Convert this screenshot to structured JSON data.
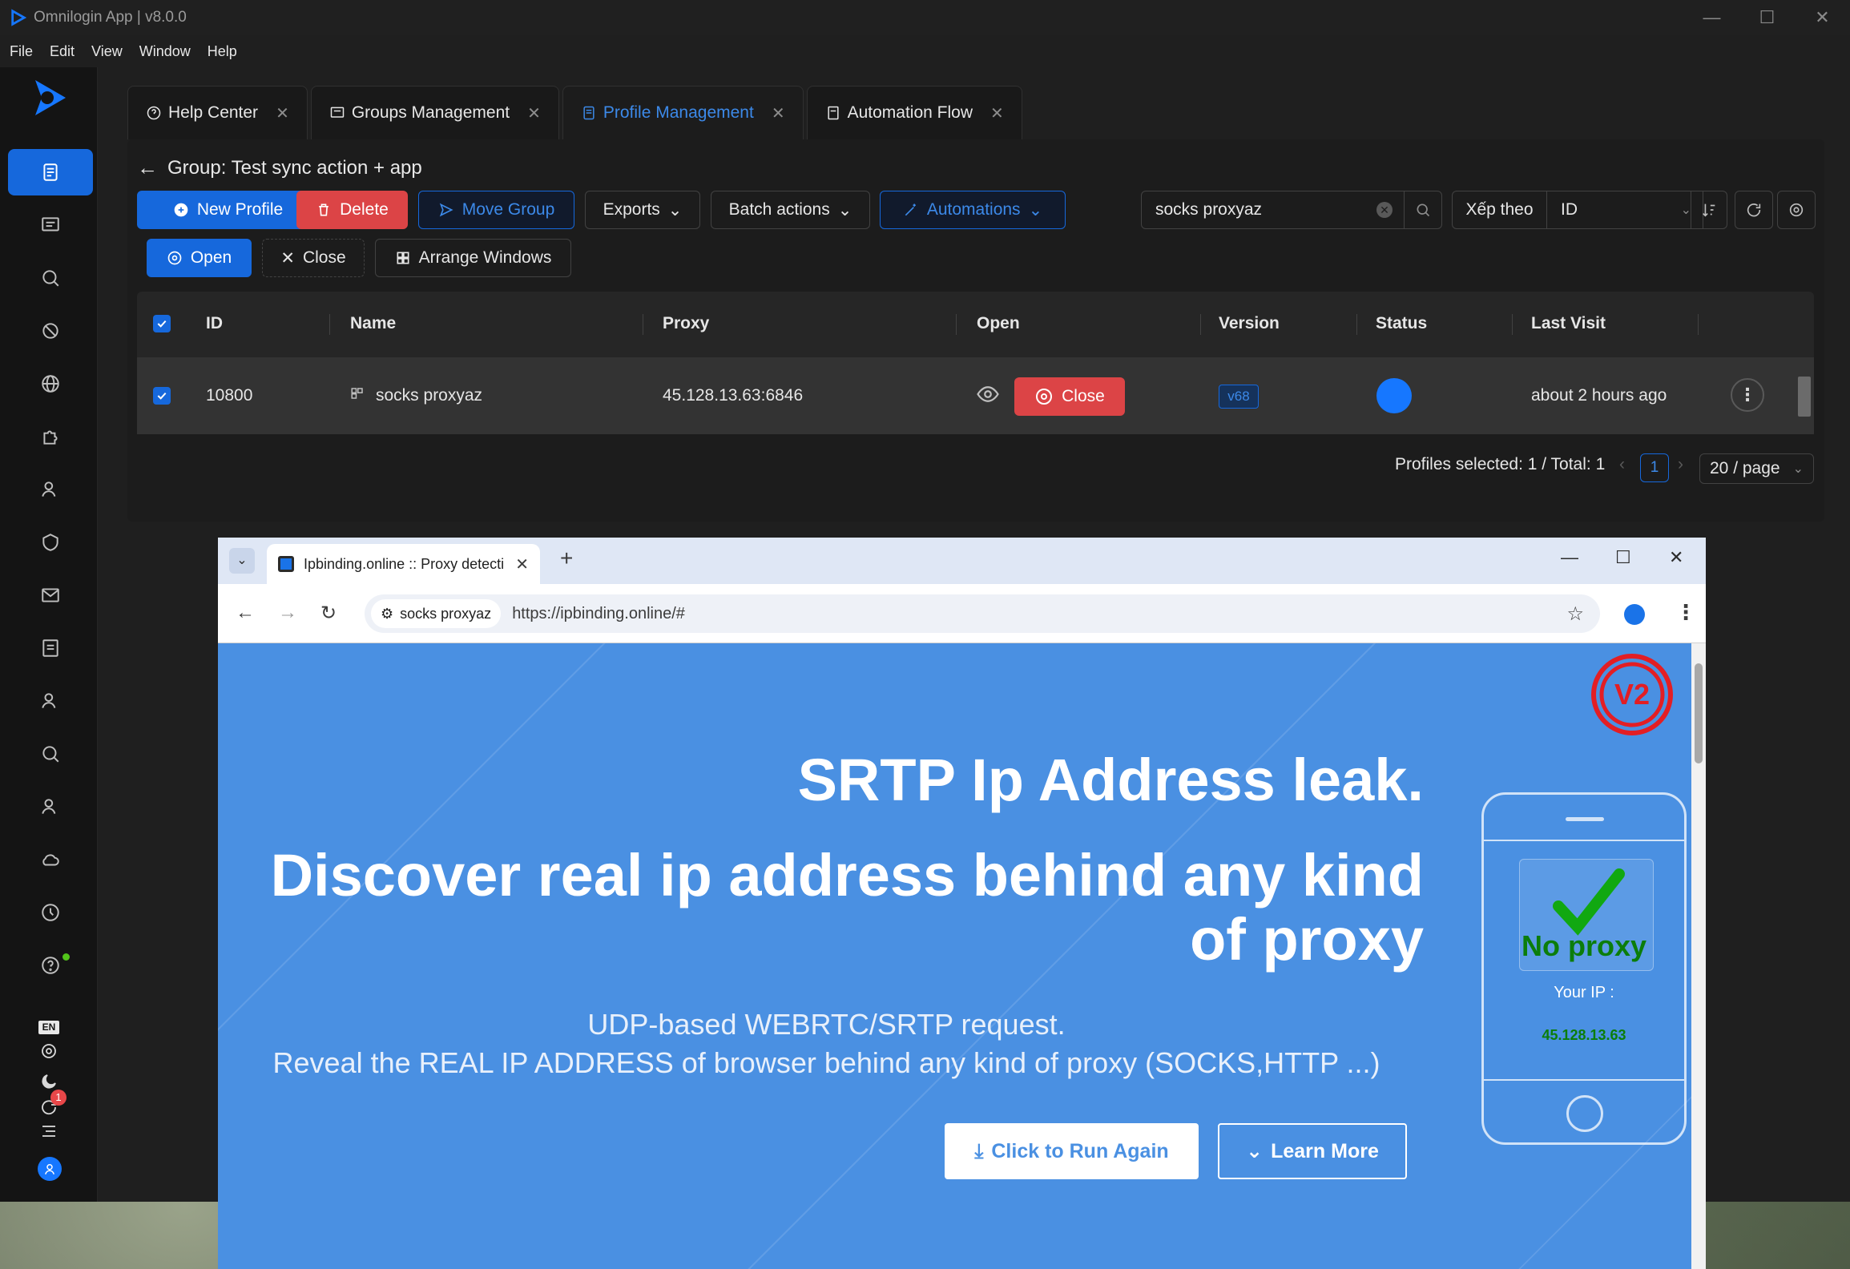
{
  "app": {
    "title": "Omnilogin App | v8.0.0",
    "menu": [
      "File",
      "Edit",
      "View",
      "Window",
      "Help"
    ]
  },
  "tabs": [
    {
      "label": "Help Center",
      "icon": "help-circle-icon"
    },
    {
      "label": "Groups Management",
      "icon": "groups-icon"
    },
    {
      "label": "Profile Management",
      "icon": "profile-doc-icon",
      "active": true
    },
    {
      "label": "Automation Flow",
      "icon": "automation-icon"
    }
  ],
  "group": {
    "title": "Group: Test sync action + app"
  },
  "toolbar": {
    "new_profile": "New Profile",
    "delete": "Delete",
    "move_group": "Move Group",
    "exports": "Exports",
    "batch_actions": "Batch actions",
    "automations": "Automations",
    "open": "Open",
    "close": "Close",
    "arrange": "Arrange Windows"
  },
  "search": {
    "value": "socks proxyaz"
  },
  "sort": {
    "label": "Xếp theo",
    "value": "ID"
  },
  "table": {
    "headers": [
      "ID",
      "Name",
      "Proxy",
      "Open",
      "Version",
      "Status",
      "Last Visit"
    ],
    "rows": [
      {
        "id": "10800",
        "name": "socks proxyaz",
        "proxy": "45.128.13.63:6846",
        "close_label": "Close",
        "version": "v68",
        "last_visit": "about 2 hours ago",
        "selected": true
      }
    ]
  },
  "pagination": {
    "summary": "Profiles selected: 1 / Total: 1",
    "page": "1",
    "page_size": "20 / page"
  },
  "sidebar": {
    "lang": "EN",
    "notification_count": "1"
  },
  "browser": {
    "tab_title": "Ipbinding.online :: Proxy detecti",
    "profile_chip": "socks proxyaz",
    "url": "https://ipbinding.online/#"
  },
  "webpage": {
    "heading1": "SRTP Ip Address leak.",
    "heading2": "Discover real ip address behind any kind of proxy",
    "line1": "UDP-based WEBRTC/SRTP request.",
    "line2": "Reveal the REAL IP ADDRESS of browser behind any kind of proxy (SOCKS,HTTP ...)",
    "run_button": "Click to Run Again",
    "learn_button": "Learn More",
    "status": "No proxy",
    "your_ip_label": "Your IP :",
    "ip": "45.128.13.63",
    "logo_text": "V2"
  },
  "colors": {
    "accent": "#1668dc",
    "danger": "#dc4446",
    "page_bg": "#4a90e2",
    "success": "#0b7d0b"
  }
}
